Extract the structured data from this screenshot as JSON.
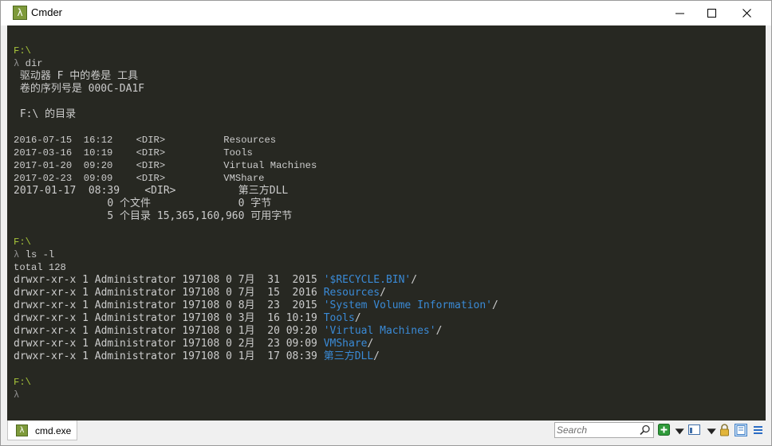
{
  "window": {
    "title": "Cmder"
  },
  "terminal": {
    "lines": [
      {
        "segments": []
      },
      {
        "segments": [
          {
            "text": "F:\\",
            "cls": "c-prompt"
          }
        ]
      },
      {
        "segments": [
          {
            "text": "λ ",
            "cls": "c-lambda"
          },
          {
            "text": "dir",
            "cls": ""
          }
        ]
      },
      {
        "cn": true,
        "segments": [
          {
            "text": " 驱动器 F 中的卷是 工具",
            "cls": ""
          }
        ]
      },
      {
        "cn": true,
        "segments": [
          {
            "text": " 卷的序列号是 000C-DA1F",
            "cls": ""
          }
        ]
      },
      {
        "segments": []
      },
      {
        "cn": true,
        "segments": [
          {
            "text": " F:\\ 的目录",
            "cls": ""
          }
        ]
      },
      {
        "segments": []
      },
      {
        "segments": [
          {
            "text": "2016-07-15  16:12    <DIR>          Resources",
            "cls": ""
          }
        ]
      },
      {
        "segments": [
          {
            "text": "2017-03-16  10:19    <DIR>          Tools",
            "cls": ""
          }
        ]
      },
      {
        "segments": [
          {
            "text": "2017-01-20  09:20    <DIR>          Virtual Machines",
            "cls": ""
          }
        ]
      },
      {
        "segments": [
          {
            "text": "2017-02-23  09:09    <DIR>          VMShare",
            "cls": ""
          }
        ]
      },
      {
        "cn": true,
        "segments": [
          {
            "text": "2017-01-17  08:39    <DIR>          第三方DLL",
            "cls": ""
          }
        ]
      },
      {
        "cn": true,
        "segments": [
          {
            "text": "               0 个文件              0 字节",
            "cls": ""
          }
        ]
      },
      {
        "cn": true,
        "segments": [
          {
            "text": "               5 个目录 15,365,160,960 可用字节",
            "cls": ""
          }
        ]
      },
      {
        "segments": []
      },
      {
        "segments": [
          {
            "text": "F:\\",
            "cls": "c-prompt"
          }
        ]
      },
      {
        "segments": [
          {
            "text": "λ ",
            "cls": "c-lambda"
          },
          {
            "text": "ls -l",
            "cls": ""
          }
        ]
      },
      {
        "segments": [
          {
            "text": "total 128",
            "cls": ""
          }
        ]
      },
      {
        "cn": true,
        "segments": [
          {
            "text": "drwxr-xr-x 1 Administrator 197108 0 7月  31  2015 ",
            "cls": ""
          },
          {
            "text": "'$RECYCLE.BIN'",
            "cls": "c-blue"
          },
          {
            "text": "/",
            "cls": ""
          }
        ]
      },
      {
        "cn": true,
        "segments": [
          {
            "text": "drwxr-xr-x 1 Administrator 197108 0 7月  15  2016 ",
            "cls": ""
          },
          {
            "text": "Resources",
            "cls": "c-blue"
          },
          {
            "text": "/",
            "cls": ""
          }
        ]
      },
      {
        "cn": true,
        "segments": [
          {
            "text": "drwxr-xr-x 1 Administrator 197108 0 8月  23  2015 ",
            "cls": ""
          },
          {
            "text": "'System Volume Information'",
            "cls": "c-blue"
          },
          {
            "text": "/",
            "cls": ""
          }
        ]
      },
      {
        "cn": true,
        "segments": [
          {
            "text": "drwxr-xr-x 1 Administrator 197108 0 3月  16 10:19 ",
            "cls": ""
          },
          {
            "text": "Tools",
            "cls": "c-blue"
          },
          {
            "text": "/",
            "cls": ""
          }
        ]
      },
      {
        "cn": true,
        "segments": [
          {
            "text": "drwxr-xr-x 1 Administrator 197108 0 1月  20 09:20 ",
            "cls": ""
          },
          {
            "text": "'Virtual Machines'",
            "cls": "c-blue"
          },
          {
            "text": "/",
            "cls": ""
          }
        ]
      },
      {
        "cn": true,
        "segments": [
          {
            "text": "drwxr-xr-x 1 Administrator 197108 0 2月  23 09:09 ",
            "cls": ""
          },
          {
            "text": "VMShare",
            "cls": "c-blue"
          },
          {
            "text": "/",
            "cls": ""
          }
        ]
      },
      {
        "cn": true,
        "segments": [
          {
            "text": "drwxr-xr-x 1 Administrator 197108 0 1月  17 08:39 ",
            "cls": ""
          },
          {
            "text": "第三方DLL",
            "cls": "c-blue"
          },
          {
            "text": "/",
            "cls": ""
          }
        ]
      },
      {
        "segments": []
      },
      {
        "segments": [
          {
            "text": "F:\\",
            "cls": "c-prompt"
          }
        ]
      },
      {
        "segments": [
          {
            "text": "λ",
            "cls": "c-lambda"
          }
        ]
      }
    ]
  },
  "statusbar": {
    "tab_label": "cmd.exe",
    "search_placeholder": "Search"
  },
  "icons": {
    "app": "lambda-icon",
    "minimize": "minimize-icon",
    "maximize": "maximize-icon",
    "close": "close-icon",
    "search": "search-icon",
    "new_tab": "plus-icon",
    "dropdown": "chevron-down-icon",
    "layout": "layout-icon",
    "lock": "lock-icon",
    "split": "split-view-icon",
    "menu": "hamburger-menu-icon"
  },
  "colors": {
    "terminal_bg": "#272822",
    "prompt": "#a6c43a",
    "link": "#3a8ad6",
    "text": "#cccccc",
    "accent_green": "#7e9a3b"
  }
}
